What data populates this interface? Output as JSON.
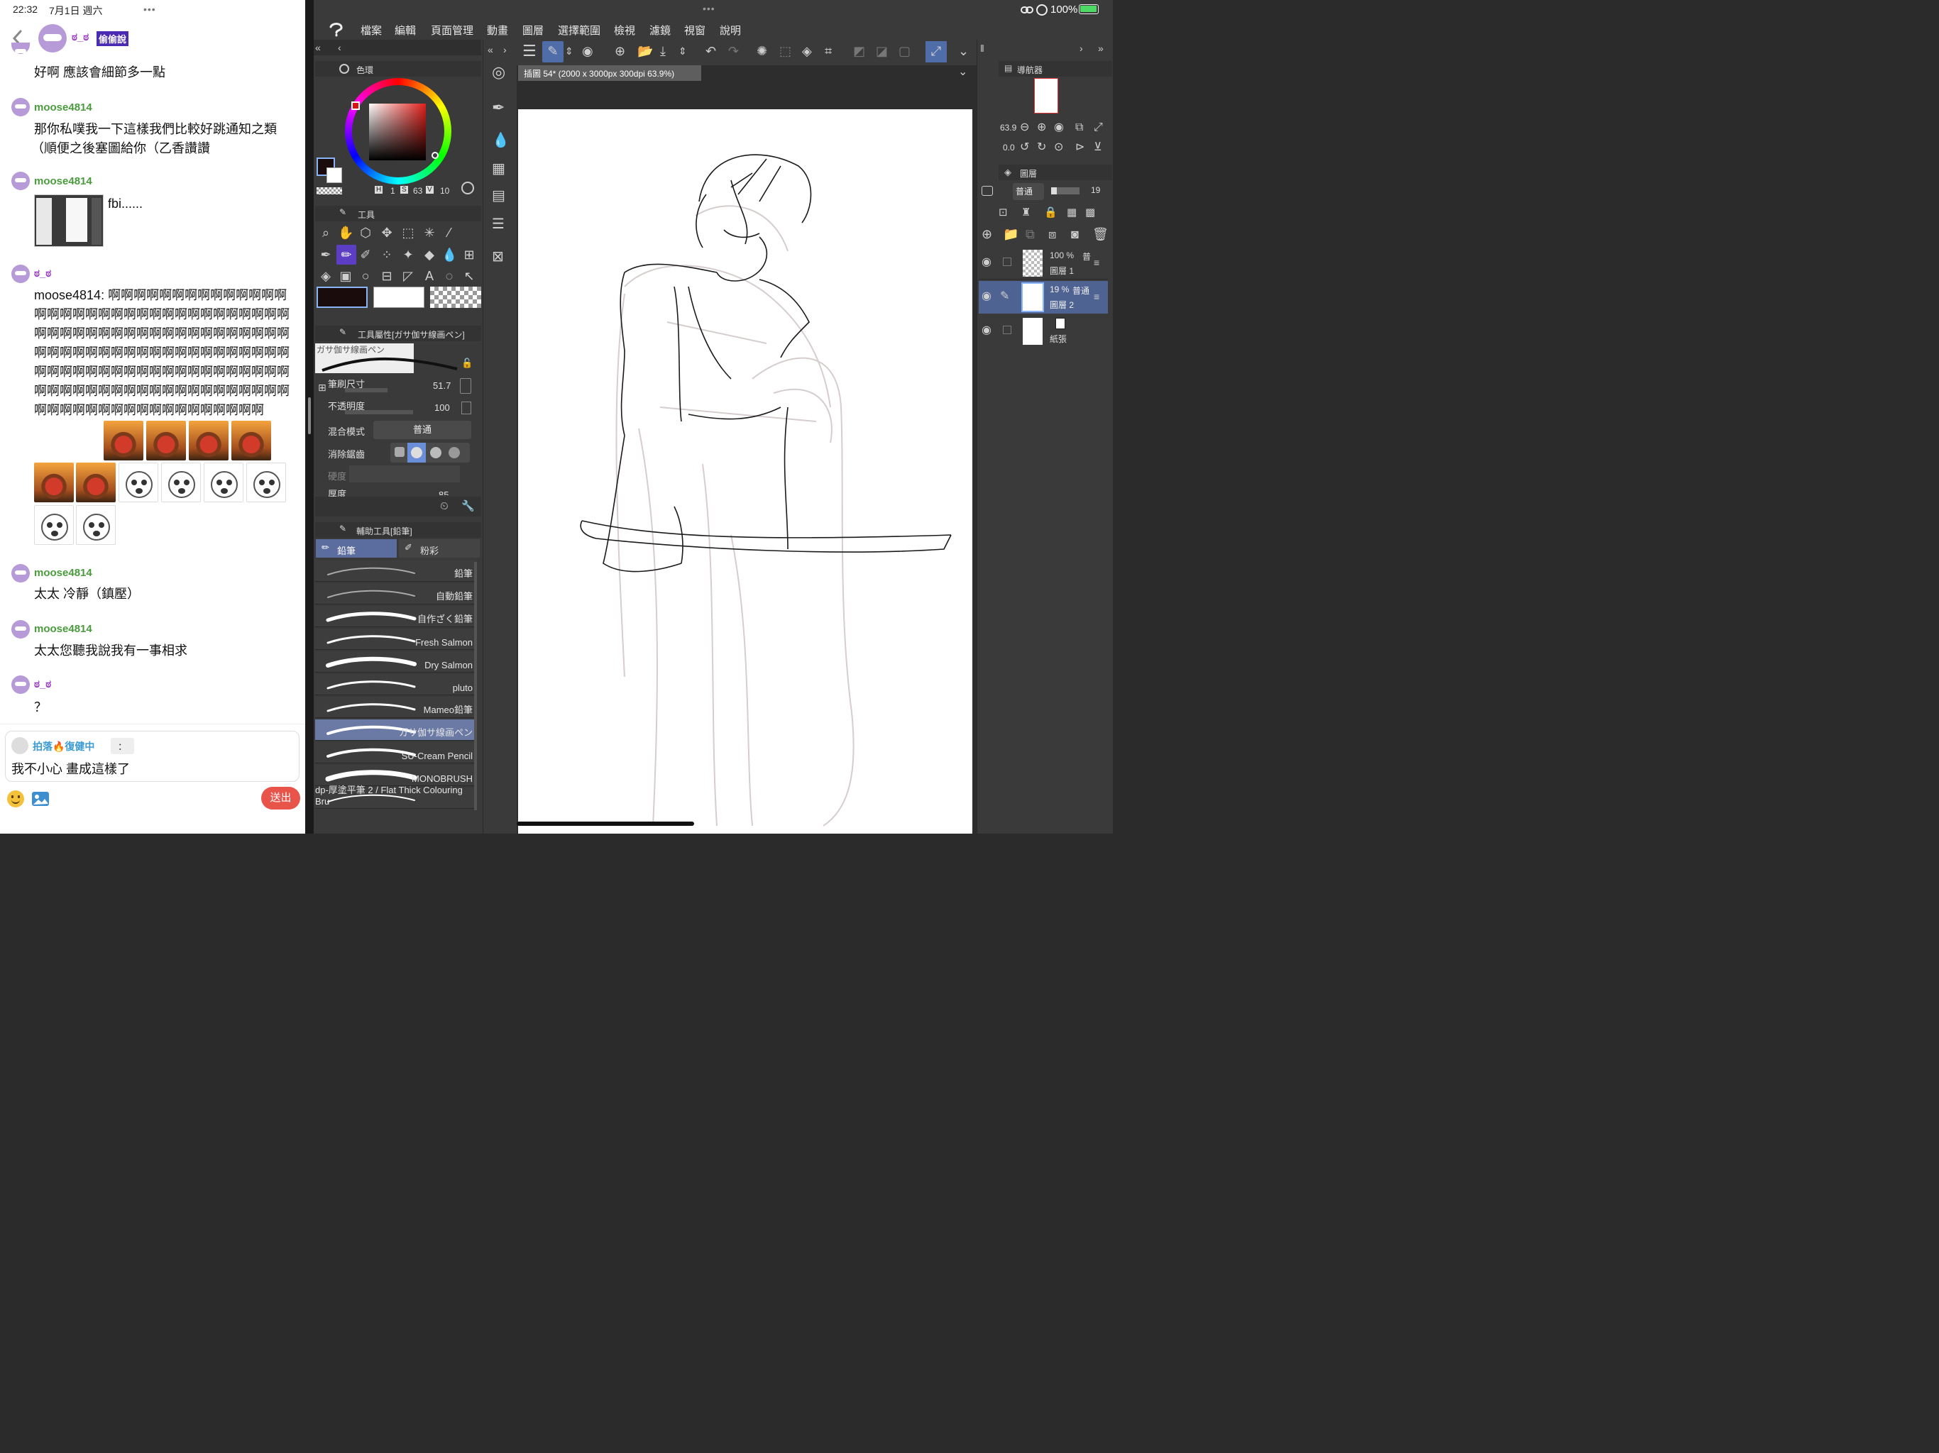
{
  "status": {
    "time": "22:32",
    "date": "7月1日 週六",
    "dots": "•••",
    "battery": "100%"
  },
  "chat": {
    "header": {
      "name": "ಠ_ಠ",
      "badge": "偷偷說"
    },
    "messages": [
      {
        "text": "好啊 應該會細節多一點"
      },
      {
        "user": "moose4814",
        "lines": [
          "那你私噗我一下這樣我們比較好跳通知之類",
          "（順便之後塞圖給你（乙香讚讚"
        ]
      },
      {
        "user": "moose4814",
        "text": "fbi......"
      },
      {
        "user": "ಠ_ಠ",
        "text": "moose4814: 啊啊啊啊啊啊啊啊啊啊啊啊啊啊啊啊啊啊啊啊啊啊啊啊啊啊啊啊啊啊啊啊啊啊啊啊啊啊啊啊啊啊啊啊啊啊啊啊啊啊啊啊啊啊啊啊啊啊啊啊啊啊啊啊啊啊啊啊啊啊啊啊啊啊啊啊啊啊啊啊啊啊啊啊啊啊啊啊啊啊啊啊啊啊啊啊啊啊啊啊啊啊啊啊啊啊啊啊啊啊啊啊啊啊啊啊啊啊啊啊啊啊啊啊啊啊啊啊啊啊啊啊"
      },
      {
        "user": "moose4814",
        "text": "太太 冷靜（鎮壓）"
      },
      {
        "user": "moose4814",
        "text": "太太您聽我說我有一事相求"
      },
      {
        "user": "ಠ_ಠ",
        "text": "？"
      }
    ],
    "composer": {
      "reply_name": "拍落🔥復健中",
      "reply_sep": "：",
      "text": "我不小心 畫成這樣了",
      "send": "送出"
    }
  },
  "csp": {
    "menu": [
      "檔案",
      "編輯",
      "頁面管理",
      "動畫",
      "圖層",
      "選擇範圍",
      "檢視",
      "濾鏡",
      "視窗",
      "說明"
    ],
    "doc_tab": "插圖 54* (2000 x 3000px 300dpi 63.9%)",
    "color_panel": {
      "title": "色環",
      "h": "1",
      "s": "63",
      "v": "10",
      "h_label": "H",
      "s_label": "S",
      "v_label": "V"
    },
    "tool_panel": {
      "title": "工具"
    },
    "tool_property": {
      "title": "工具屬性[ガサ伽サ線画ペン]",
      "brush_preview": "ガサ伽サ線画ペン",
      "size_label": "筆刷尺寸",
      "size_value": "51.7",
      "opacity_label": "不透明度",
      "opacity_value": "100",
      "blend_label": "混合模式",
      "blend_value": "普通",
      "aa_label": "消除鋸齒",
      "hardness_label": "硬度",
      "thickness_label": "厚度",
      "thickness_value": "85"
    },
    "subtool": {
      "title": "輔助工具[鉛筆]",
      "tabs": [
        "鉛筆",
        "粉彩"
      ],
      "brushes": [
        "鉛筆",
        "自動鉛筆",
        "自作ざく鉛筆",
        "Fresh Salmon",
        "Dry Salmon",
        "pluto",
        "Mameo鉛筆",
        "ガサ伽サ線画ペン",
        "SU-Cream Pencil",
        "MONOBRUSH",
        "dp-厚塗平筆 2 / Flat Thick Colouring Bru"
      ]
    },
    "navigator": {
      "title": "導航器",
      "zoom": "63.9",
      "rotate": "0.0"
    },
    "layers": {
      "title": "圖層",
      "blend": "普通",
      "opacity": "19",
      "items": [
        {
          "percent": "100 %",
          "mode": "普",
          "name": "圖層 1"
        },
        {
          "percent": "19 %",
          "mode": "普通",
          "name": "圖層 2"
        },
        {
          "name": "紙張"
        }
      ]
    }
  },
  "colors": {
    "accent": "#6a4fc3",
    "chat_green": "#4a9b3c",
    "chat_purple": "#9b3fc6",
    "send_btn": "#e8534a"
  }
}
